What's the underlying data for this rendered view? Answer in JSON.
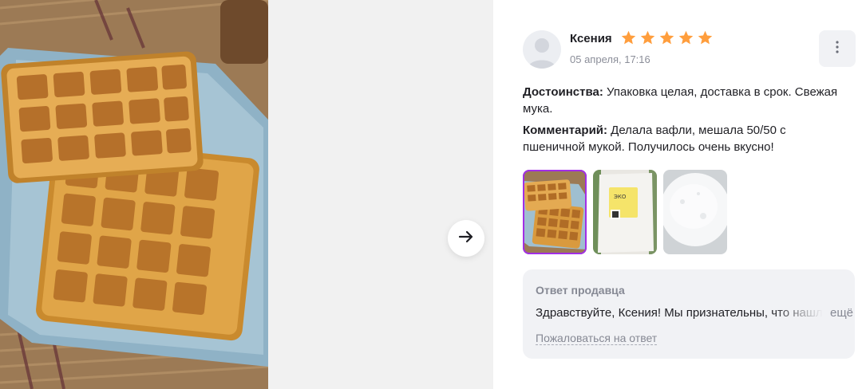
{
  "photo_viewer": {
    "photo_icon": "waffles-photo",
    "next_icon": "arrow-right-icon"
  },
  "review": {
    "author": "Ксения",
    "rating": 5,
    "rating_max": 5,
    "date": "05 апреля, 17:16",
    "pros_label": "Достоинства:",
    "pros_text": " Упаковка целая, доставка в срок. Свежая мука.",
    "comment_label": "Комментарий:",
    "comment_text": " Делала вафли, мешала 50/50 с пшеничной мукой. Получилось очень вкусно!",
    "thumbnails": [
      {
        "icon": "waffles-thumbnail",
        "active": true
      },
      {
        "icon": "flour-package-thumbnail",
        "active": false
      },
      {
        "icon": "flour-closeup-thumbnail",
        "active": false
      }
    ]
  },
  "seller_reply": {
    "title": "Ответ продавца",
    "text": "Здравствуйте, Ксения! Мы признательны, что нашли время оставить отзыв",
    "more_label": "ещё",
    "complain_label": "Пожаловаться на ответ"
  },
  "colors": {
    "star": "#ff9e3d",
    "accent": "#a12ee6",
    "muted": "#868994",
    "panel_bg": "#f1f2f5"
  }
}
